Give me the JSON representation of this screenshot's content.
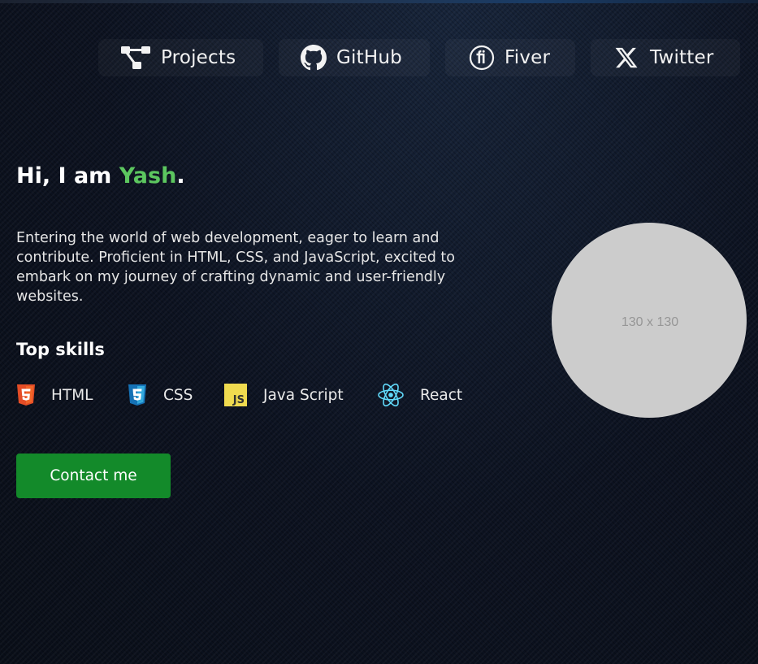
{
  "nav": {
    "items": [
      {
        "label": "Projects",
        "icon": "sitemap-icon"
      },
      {
        "label": "GitHub",
        "icon": "github-icon"
      },
      {
        "label": "Fiver",
        "icon": "fiverr-icon"
      },
      {
        "label": "Twitter",
        "icon": "x-twitter-icon"
      }
    ]
  },
  "hero": {
    "greeting_prefix": "Hi, I am ",
    "name": "Yash",
    "greeting_suffix": ".",
    "intro": "Entering the world of web development, eager to learn and contribute. Proficient in HTML, CSS, and JavaScript, excited to embark on my journey of crafting dynamic and user-friendly websites.",
    "skills_title": "Top skills",
    "skills": [
      {
        "label": "HTML",
        "icon": "html5-icon"
      },
      {
        "label": "CSS",
        "icon": "css3-icon"
      },
      {
        "label": "Java Script",
        "icon": "javascript-icon"
      },
      {
        "label": "React",
        "icon": "react-icon"
      }
    ],
    "contact_label": "Contact me"
  },
  "avatar": {
    "placeholder_text": "130 x 130"
  },
  "colors": {
    "accent_name": "#5cc65f",
    "button_bg": "#138a2a",
    "background": "#0b111c",
    "avatar_bg": "#cccccc",
    "html_orange": "#e44d26",
    "css_blue": "#1572b6",
    "js_yellow": "#f0db4f",
    "react_cyan": "#61dafb"
  }
}
